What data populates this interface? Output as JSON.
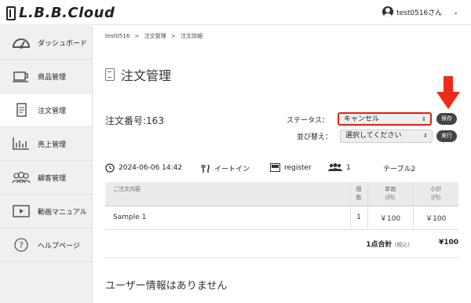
{
  "header": {
    "logo_text": "L.B.B.Cloud",
    "username": "test0516さん"
  },
  "sidebar": {
    "items": [
      {
        "label": "ダッシュボード",
        "icon": "dashboard-icon"
      },
      {
        "label": "商品管理",
        "icon": "cup-icon"
      },
      {
        "label": "注文管理",
        "icon": "document-icon",
        "active": true
      },
      {
        "label": "売上管理",
        "icon": "bar-chart-icon"
      },
      {
        "label": "顧客管理",
        "icon": "users-icon"
      },
      {
        "label": "動画マニュアル",
        "icon": "play-icon"
      },
      {
        "label": "ヘルプページ",
        "icon": "help-icon"
      }
    ]
  },
  "breadcrumb": [
    "test0516",
    ">",
    "注文管理",
    ">",
    "注文詳細"
  ],
  "page": {
    "title": "注文管理",
    "order_number": "注文番号:163",
    "status_label": "ステータス：",
    "status_value": "キャンセル",
    "save_label": "保存",
    "sort_label": "並び替え：",
    "sort_value": "選択してください",
    "exec_label": "実行"
  },
  "info": {
    "datetime": "2024-06-06 14:42",
    "service": "イートイン",
    "register": "register",
    "people": "1",
    "table": "テーブル2"
  },
  "table": {
    "headers": {
      "content": "ご注文内容",
      "qty_line1": "個",
      "qty_line2": "数",
      "price_line1": "単価",
      "price_line2": "(円)",
      "subtotal_line1": "小計",
      "subtotal_line2": "(円)"
    },
    "rows": [
      {
        "name": "Sample 1",
        "qty": "1",
        "price": "￥100",
        "subtotal": "￥100"
      }
    ]
  },
  "total": {
    "label": "1点合計",
    "tax": "(税込)",
    "value": "¥100"
  },
  "user_info": {
    "message": "ユーザー情報はありません"
  },
  "colors": {
    "highlight": "#d9241b",
    "arrow": "#ee2a1a"
  }
}
